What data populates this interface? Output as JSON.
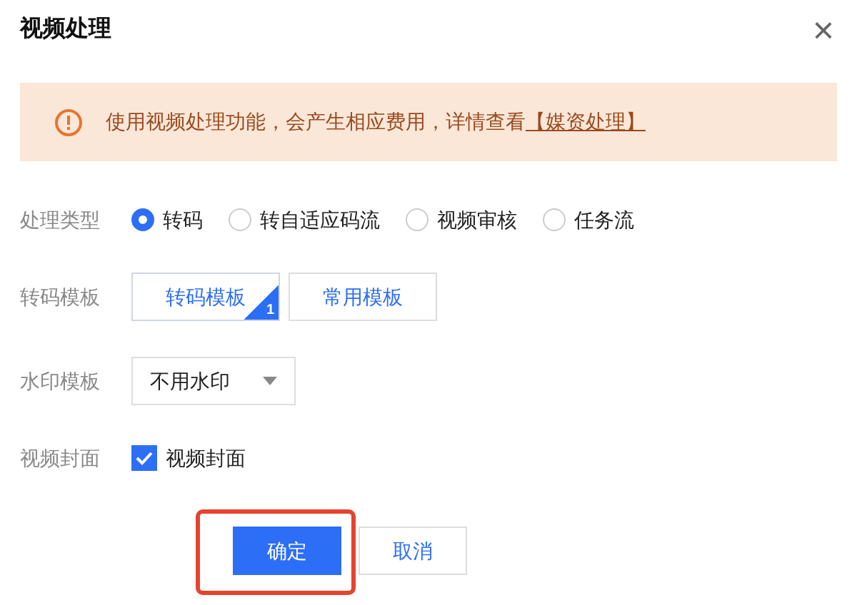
{
  "dialog": {
    "title": "视频处理",
    "close": "×"
  },
  "alert": {
    "text": "使用视频处理功能，会产生相应费用，详情查看",
    "link": "【媒资处理】"
  },
  "form": {
    "type": {
      "label": "处理类型",
      "options": [
        {
          "label": "转码",
          "selected": true
        },
        {
          "label": "转自适应码流",
          "selected": false
        },
        {
          "label": "视频审核",
          "selected": false
        },
        {
          "label": "任务流",
          "selected": false
        }
      ]
    },
    "template": {
      "label": "转码模板",
      "tabs": [
        {
          "label": "转码模板",
          "selected": true,
          "badge": "1"
        },
        {
          "label": "常用模板",
          "selected": false
        }
      ]
    },
    "watermark": {
      "label": "水印模板",
      "value": "不用水印"
    },
    "cover": {
      "label": "视频封面",
      "checkbox": {
        "label": "视频封面",
        "checked": true
      }
    }
  },
  "buttons": [
    {
      "label": "确定",
      "kind": "primary",
      "highlighted": true
    },
    {
      "label": "取消",
      "kind": "secondary",
      "highlighted": false
    }
  ]
}
